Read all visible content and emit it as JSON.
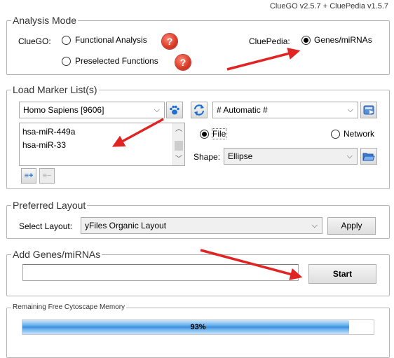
{
  "version_label": "ClueGO v2.5.7 + CluePedia v1.5.7",
  "analysis_mode": {
    "legend": "Analysis Mode",
    "cluego_label": "ClueGO:",
    "functional_analysis": "Functional Analysis",
    "preselected_functions": "Preselected Functions",
    "cluepedia_label": "CluePedia:",
    "genes_mirnas": "Genes/miRNAs",
    "help_glyph": "?"
  },
  "marker_list": {
    "legend": "Load Marker List(s)",
    "organism": "Homo Sapiens [9606]",
    "identifier": "# Automatic #",
    "items": [
      "hsa-miR-449a",
      "hsa-miR-33"
    ],
    "file_label": "File",
    "network_label": "Network",
    "shape_label": "Shape:",
    "shape_value": "Ellipse",
    "add_list_glyph": "≡+",
    "remove_list_glyph": "≡−"
  },
  "preferred_layout": {
    "legend": "Preferred Layout",
    "select_label": "Select Layout:",
    "layout_value": "yFiles Organic Layout",
    "apply_label": "Apply"
  },
  "add_genes": {
    "legend": "Add Genes/miRNAs",
    "input_value": "",
    "start_label": "Start"
  },
  "memory": {
    "legend": "Remaining Free Cytoscape Memory",
    "percent": 0.93,
    "label": "93%"
  },
  "colors": {
    "annotation_arrow": "#e02424",
    "help_icon": "#d83a24",
    "progress": "#3a8fdc"
  }
}
